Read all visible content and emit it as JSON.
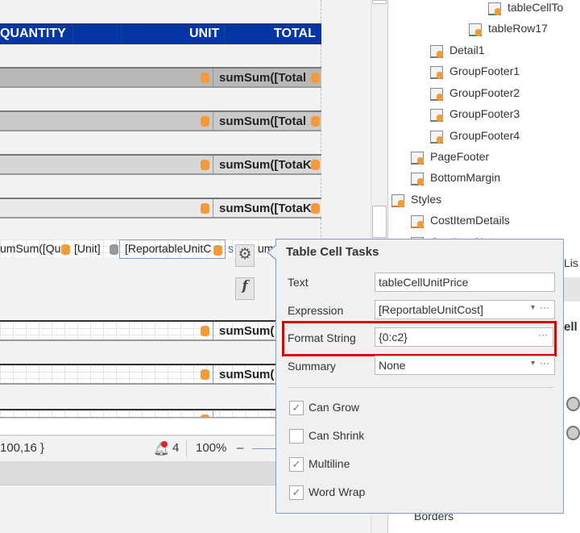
{
  "colors": {
    "header_bg": "#0437a3",
    "highlight": "#e00000",
    "datasource_icon": "#f39a3a"
  },
  "table_header": {
    "quantity": "QUANTITY",
    "unit": "UNIT",
    "total": "TOTAL"
  },
  "group_bands": [
    {
      "text": "sumSum([Total",
      "bg": "#b9b9b9"
    },
    {
      "text": "sumSum([Total",
      "bg": "#c9c9c9"
    },
    {
      "text": "sumSum([TotaK",
      "bg": "#d7d7d7"
    },
    {
      "text": "sumSum([TotaK",
      "bg": "#e9e9e9"
    }
  ],
  "detail_row": {
    "cell1": "umSum([Qu",
    "cell2": "[Unit]",
    "cell3": "[ReportableUnitC",
    "cell4": "s",
    "cell5": "um"
  },
  "lower_bands": [
    {
      "text": "sumSum("
    },
    {
      "text": "sumSum("
    },
    {
      "text": "s"
    }
  ],
  "smart_tag": {
    "gear": "gear-icon",
    "fx": "f"
  },
  "status": {
    "coords": "100,16 }",
    "notifications": "4",
    "zoom": "100%",
    "zoom_out": "–"
  },
  "tree": {
    "items": [
      {
        "label": "tableCellTo",
        "icon": "table-cell-icon"
      },
      {
        "label": "tableRow17",
        "icon": "table-row-icon",
        "chevron": ">"
      },
      {
        "label": "Detail1",
        "icon": "detail-band-icon"
      },
      {
        "label": "GroupFooter1",
        "icon": "group-footer-icon",
        "chevron": ">"
      },
      {
        "label": "GroupFooter2",
        "icon": "group-footer-icon",
        "chevron": ">"
      },
      {
        "label": "GroupFooter3",
        "icon": "group-footer-icon",
        "chevron": ">"
      },
      {
        "label": "GroupFooter4",
        "icon": "group-footer-icon",
        "chevron": ">"
      },
      {
        "label": "PageFooter",
        "icon": "page-footer-icon",
        "chevron": ">"
      },
      {
        "label": "BottomMargin",
        "icon": "bottom-margin-icon"
      },
      {
        "label": "Styles",
        "icon": "styles-icon",
        "chevron": "⌄"
      },
      {
        "label": "CostItemDetails",
        "icon": "style-icon"
      },
      {
        "label": "CostItemNotes",
        "icon": "style-icon"
      }
    ]
  },
  "right_panel": {
    "tab_partial": "Lis",
    "section_partial": "ell",
    "borders_label": "Borders"
  },
  "popup": {
    "title": "Table Cell Tasks",
    "text_label": "Text",
    "text_value": "tableCellUnitPrice",
    "expression_label": "Expression",
    "expression_value": "[ReportableUnitCost]",
    "format_label": "Format String",
    "format_value": "{0:c2}",
    "summary_label": "Summary",
    "summary_value": "None",
    "ellipsis": "···",
    "dropdown": "▾",
    "checkboxes": [
      {
        "label": "Can Grow",
        "checked": true
      },
      {
        "label": "Can Shrink",
        "checked": false
      },
      {
        "label": "Multiline",
        "checked": true
      },
      {
        "label": "Word Wrap",
        "checked": true
      }
    ]
  }
}
